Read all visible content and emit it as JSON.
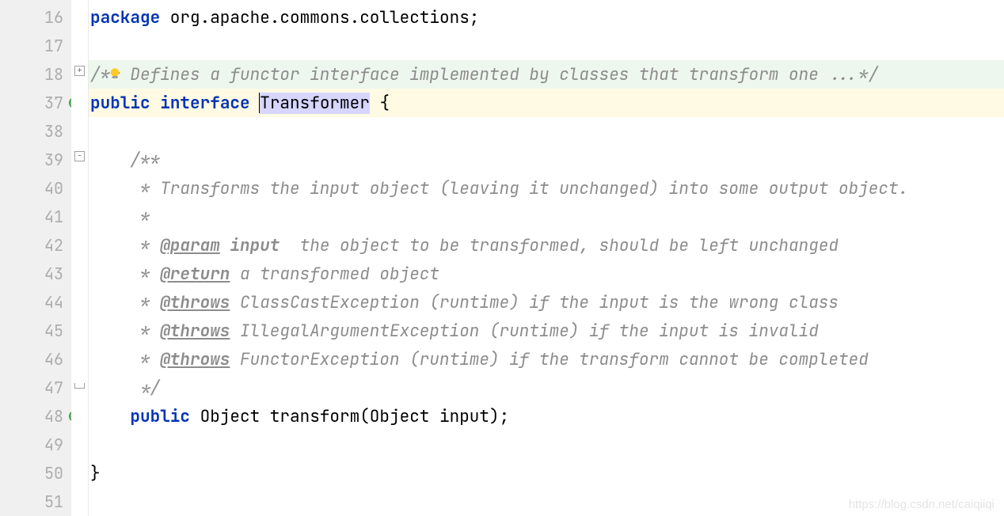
{
  "lines": [
    {
      "num": "16"
    },
    {
      "num": "17"
    },
    {
      "num": "18"
    },
    {
      "num": "37"
    },
    {
      "num": "38"
    },
    {
      "num": "39"
    },
    {
      "num": "40"
    },
    {
      "num": "41"
    },
    {
      "num": "42"
    },
    {
      "num": "43"
    },
    {
      "num": "44"
    },
    {
      "num": "45"
    },
    {
      "num": "46"
    },
    {
      "num": "47"
    },
    {
      "num": "48"
    },
    {
      "num": "49"
    },
    {
      "num": "50"
    },
    {
      "num": "51"
    }
  ],
  "code": {
    "l16_kw": "package",
    "l16_pkg": " org.apache.commons.collections;",
    "l18_comment": "/** Defines a functor interface implemented by classes that transform one ...*/",
    "l37_kw1": "public",
    "l37_kw2": "interface",
    "l37_class": "Transformer",
    "l37_brace": " {",
    "l39_c": "    /**",
    "l40_c": "     * Transforms the input object (leaving it unchanged) into some output object.",
    "l41_c": "     *",
    "l42_pre": "     * ",
    "l42_tag": "@param",
    "l42_param": " input",
    "l42_desc": "  the object to be transformed, should be left unchanged",
    "l43_pre": "     * ",
    "l43_tag": "@return",
    "l43_desc": " a transformed object",
    "l44_pre": "     * ",
    "l44_tag": "@throws",
    "l44_desc": " ClassCastException (runtime) if the input is the wrong class",
    "l45_pre": "     * ",
    "l45_tag": "@throws",
    "l45_desc": " IllegalArgumentException (runtime) if the input is invalid",
    "l46_pre": "     * ",
    "l46_tag": "@throws",
    "l46_desc": " FunctorException (runtime) if the transform cannot be completed",
    "l47_c": "     */",
    "l48_kw": "    public",
    "l48_rest": " Object transform(Object input);",
    "l50_brace": "}"
  },
  "fold": {
    "plus": "+",
    "minus": "−"
  },
  "watermark": "https://blog.csdn.net/caiqiiqi"
}
